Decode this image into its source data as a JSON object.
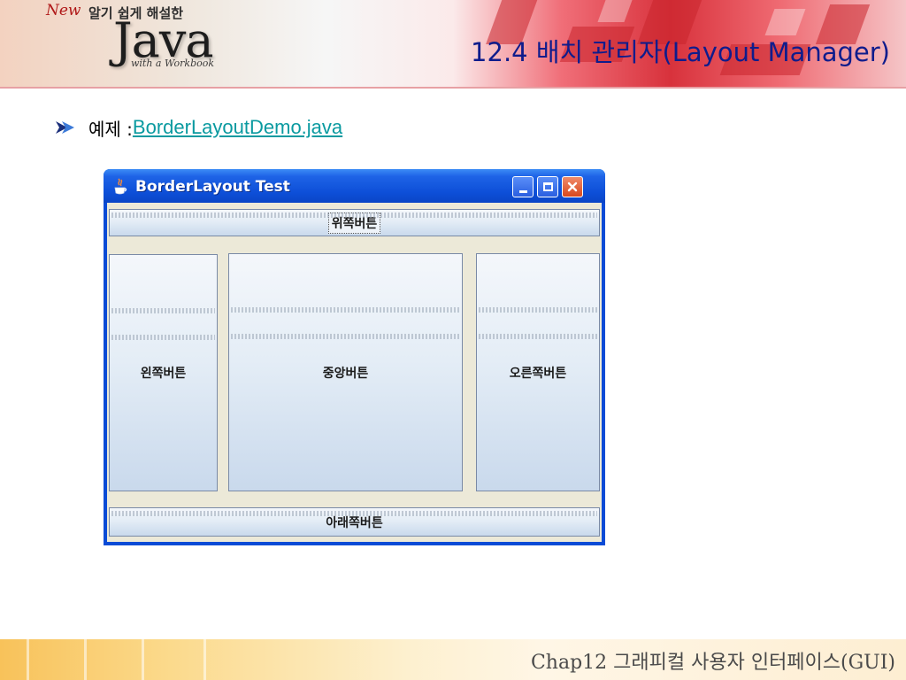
{
  "header": {
    "logo": {
      "new_word": "New",
      "subtitle": "알기 쉽게 해설한",
      "wordmark": "Java",
      "tagline": "with a Workbook"
    },
    "title": "12.4 배치 관리자(Layout Manager)"
  },
  "bullet": {
    "label": "예제 : ",
    "link_text": "BorderLayoutDemo.java",
    "arrow_icon": "arrow-right-icon"
  },
  "window": {
    "title": "BorderLayout Test",
    "icon": "java-cup-icon",
    "controls": [
      "minimize",
      "maximize",
      "close"
    ],
    "buttons": {
      "north": "위쪽버튼",
      "west": "왼쪽버튼",
      "center": "중앙버튼",
      "east": "오른쪽버튼",
      "south": "아래쪽버튼"
    }
  },
  "footer": {
    "text": "Chap12 그래피컬 사용자 인터페이스(GUI)"
  },
  "colors": {
    "title": "#0f1c8c",
    "link": "#0a9aa0",
    "xp_title_blue": "#0d4fd8"
  }
}
